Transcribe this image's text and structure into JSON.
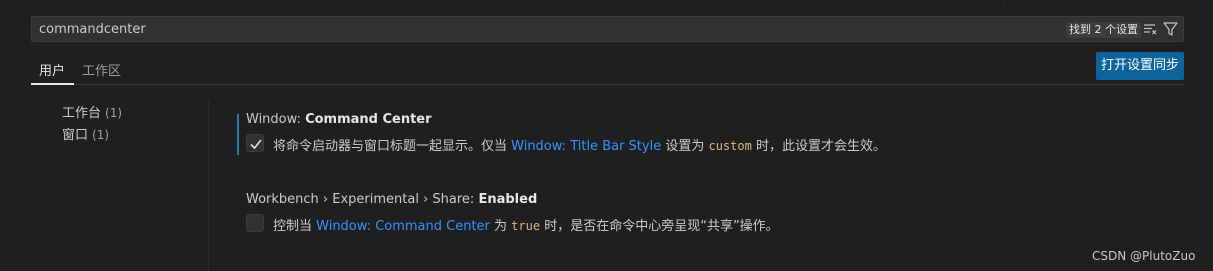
{
  "search": {
    "value": "commandcenter",
    "result_count": "找到 2 个设置",
    "clear_icon": "clear-filter-icon",
    "filter_icon": "filter-icon"
  },
  "tabs": [
    {
      "label": "用户",
      "active": true
    },
    {
      "label": "工作区",
      "active": false
    }
  ],
  "sync_button": {
    "label": "打开设置同步",
    "color": "#0e639c"
  },
  "toc": [
    {
      "label": "工作台",
      "count": "(1)"
    },
    {
      "label": "窗口",
      "count": "(1)"
    }
  ],
  "settings": [
    {
      "category": "Window: ",
      "name": "Command Center",
      "checked": true,
      "desc_pre": "将命令启动器与窗口标题一起显示。仅当 ",
      "desc_link": "Window: Title Bar Style",
      "desc_mid": " 设置为 ",
      "desc_code": "custom",
      "desc_post": " 时，此设置才会生效。"
    },
    {
      "category": "Workbench › Experimental › Share: ",
      "name": "Enabled",
      "checked": false,
      "desc_pre": "控制当 ",
      "desc_link": "Window: Command Center",
      "desc_mid": " 为 ",
      "desc_code": "true",
      "desc_post": " 时，是否在命令中心旁呈现“共享”操作。"
    }
  ],
  "watermark": "CSDN @PlutoZuo",
  "colors": {
    "background": "#1f1f1f",
    "link": "#3794ff",
    "code": "#d7ba7d",
    "focus": "#2b79a5"
  }
}
